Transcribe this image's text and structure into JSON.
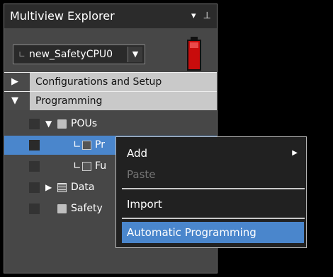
{
  "explorer": {
    "title": "Multiview Explorer",
    "dropdown_glyph": "▾",
    "pin_glyph": "⊥"
  },
  "cpu_selector": {
    "prefix": "∟",
    "value": "new_SafetyCPU0",
    "arrow": "▼"
  },
  "sections": [
    {
      "label": "Configurations and Setup",
      "expander": "▶"
    },
    {
      "label": "Programming",
      "expander": "▼"
    }
  ],
  "tree": {
    "pous": {
      "label": "POUs",
      "expander": "▼"
    },
    "programs": {
      "label": "Pr",
      "prefix": "∟"
    },
    "functions": {
      "label": "Fu",
      "prefix": "∟"
    },
    "data": {
      "label": "Data",
      "expander": "▶"
    },
    "safety": {
      "label": "Safety"
    }
  },
  "context_menu": {
    "items": [
      {
        "label": "Add",
        "submenu_arrow": "▶",
        "disabled": false
      },
      {
        "label": "Paste",
        "disabled": true
      },
      {
        "label": "Import",
        "disabled": false
      },
      {
        "label": "Automatic Programming",
        "disabled": false,
        "highlighted": true
      }
    ]
  },
  "colors": {
    "selection_blue": "#4a86cc",
    "panel_gray": "#474747",
    "battery_red": "#c80c0c"
  }
}
